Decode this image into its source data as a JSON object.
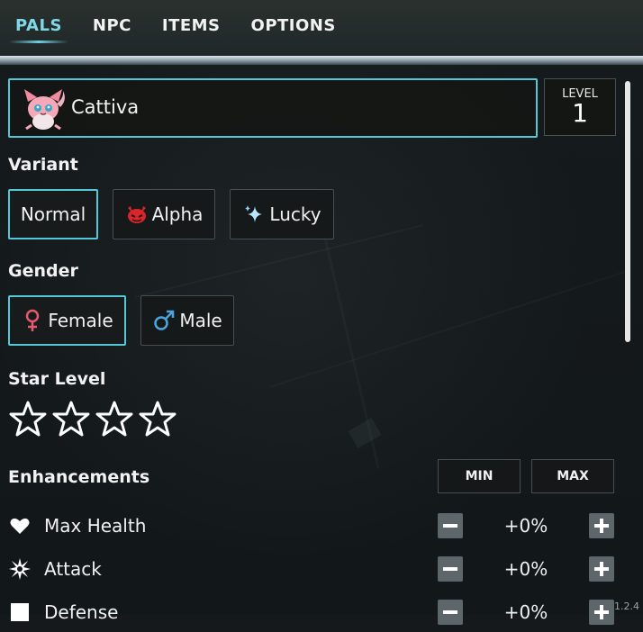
{
  "nav": {
    "tabs": [
      {
        "label": "PALS",
        "active": true
      },
      {
        "label": "NPC",
        "active": false
      },
      {
        "label": "ITEMS",
        "active": false
      },
      {
        "label": "OPTIONS",
        "active": false
      }
    ]
  },
  "pal": {
    "name": "Cattiva",
    "level_label": "LEVEL",
    "level": "1",
    "avatar_icon": "cattiva-pal-icon"
  },
  "variant": {
    "title": "Variant",
    "options": [
      {
        "label": "Normal",
        "selected": true,
        "icon": ""
      },
      {
        "label": "Alpha",
        "selected": false,
        "icon": "red-demon-icon"
      },
      {
        "label": "Lucky",
        "selected": false,
        "icon": "sparkle-icon"
      }
    ]
  },
  "gender": {
    "title": "Gender",
    "options": [
      {
        "label": "Female",
        "selected": true,
        "icon": "female-symbol-icon",
        "color": "#e8596e"
      },
      {
        "label": "Male",
        "selected": false,
        "icon": "male-symbol-icon",
        "color": "#4aa6de"
      }
    ]
  },
  "star_level": {
    "title": "Star Level",
    "value": 0,
    "max": 4
  },
  "enhancements": {
    "title": "Enhancements",
    "min_label": "MIN",
    "max_label": "MAX",
    "rows": [
      {
        "label": "Max Health",
        "icon": "heart-icon",
        "value": "+0%"
      },
      {
        "label": "Attack",
        "icon": "burst-icon",
        "value": "+0%"
      },
      {
        "label": "Defense",
        "icon": "shield-icon",
        "value": "+0%"
      }
    ]
  },
  "version": "1.2.4",
  "colors": {
    "accent": "#56c7d6",
    "background": "#15191c",
    "button": "#5d666a"
  }
}
